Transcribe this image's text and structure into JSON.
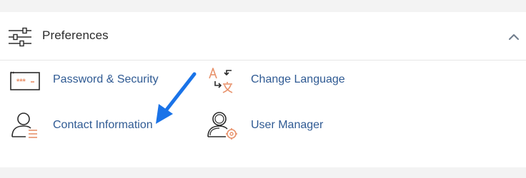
{
  "section": {
    "title": "Preferences",
    "header_icon": "sliders-icon",
    "collapse_icon": "chevron-up-icon"
  },
  "items": [
    {
      "label": "Password & Security",
      "icon": "password-field-icon"
    },
    {
      "label": "Contact Information",
      "icon": "contact-card-icon"
    },
    {
      "label": "Change Language",
      "icon": "translate-icon"
    },
    {
      "label": "User Manager",
      "icon": "user-manager-icon"
    }
  ],
  "annotation": {
    "icon": "pointer-arrow-icon",
    "color": "#1a73e8"
  },
  "colors": {
    "link": "#2f5a93",
    "accent": "#e8916a",
    "icon_dark": "#2b2b2b"
  }
}
